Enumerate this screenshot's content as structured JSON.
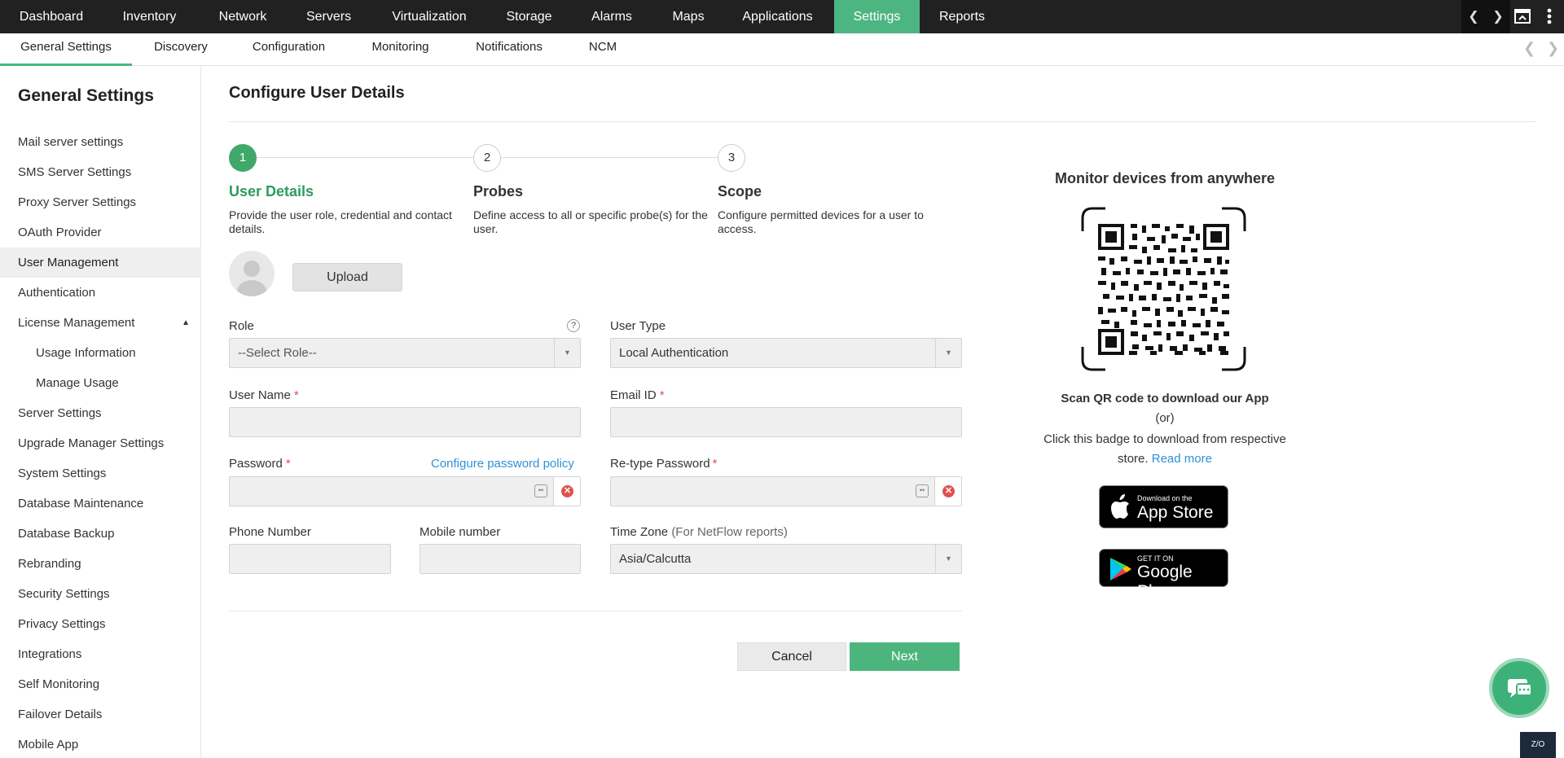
{
  "top_nav": {
    "items": [
      {
        "label": "Dashboard"
      },
      {
        "label": "Inventory"
      },
      {
        "label": "Network"
      },
      {
        "label": "Servers"
      },
      {
        "label": "Virtualization"
      },
      {
        "label": "Storage"
      },
      {
        "label": "Alarms"
      },
      {
        "label": "Maps"
      },
      {
        "label": "Applications"
      },
      {
        "label": "Settings",
        "active": true
      },
      {
        "label": "Reports"
      }
    ]
  },
  "sub_nav": {
    "items": [
      {
        "label": "General Settings",
        "active": true
      },
      {
        "label": "Discovery"
      },
      {
        "label": "Configuration"
      },
      {
        "label": "Monitoring"
      },
      {
        "label": "Notifications"
      },
      {
        "label": "NCM"
      }
    ]
  },
  "sidebar": {
    "title": "General Settings",
    "items": [
      {
        "label": "Mail server settings"
      },
      {
        "label": "SMS Server Settings"
      },
      {
        "label": "Proxy Server Settings"
      },
      {
        "label": "OAuth Provider"
      },
      {
        "label": "User Management",
        "active": true
      },
      {
        "label": "Authentication"
      },
      {
        "label": "License Management",
        "expanded": true
      },
      {
        "label": "Usage Information",
        "sub": true
      },
      {
        "label": "Manage Usage",
        "sub": true
      },
      {
        "label": "Server Settings"
      },
      {
        "label": "Upgrade Manager Settings"
      },
      {
        "label": "System Settings"
      },
      {
        "label": "Database Maintenance"
      },
      {
        "label": "Database Backup"
      },
      {
        "label": "Rebranding"
      },
      {
        "label": "Security Settings"
      },
      {
        "label": "Privacy Settings"
      },
      {
        "label": "Integrations"
      },
      {
        "label": "Self Monitoring"
      },
      {
        "label": "Failover Details"
      },
      {
        "label": "Mobile App"
      }
    ]
  },
  "page": {
    "title": "Configure User Details",
    "steps": [
      {
        "number": "1",
        "title": "User Details",
        "desc": "Provide the user role, credential and contact details.",
        "active": true
      },
      {
        "number": "2",
        "title": "Probes",
        "desc": "Define access to all or specific probe(s) for the user."
      },
      {
        "number": "3",
        "title": "Scope",
        "desc": "Configure permitted devices for a user to access."
      }
    ],
    "upload_label": "Upload"
  },
  "form": {
    "role_label": "Role",
    "role_help": "?",
    "role_value": "--Select Role--",
    "user_type_label": "User Type",
    "user_type_value": "Local Authentication",
    "user_name_label": "User Name",
    "email_label": "Email ID",
    "password_label": "Password",
    "password_policy_link": "Configure password policy",
    "retype_label": "Re-type Password",
    "required_mark": "*",
    "phone_label": "Phone Number",
    "mobile_label": "Mobile number",
    "timezone_label": "Time Zone",
    "timezone_hint": "(For NetFlow reports)",
    "timezone_value": "Asia/Calcutta",
    "cancel_label": "Cancel",
    "next_label": "Next"
  },
  "right_panel": {
    "title": "Monitor devices from anywhere",
    "scan_text": "Scan QR code to download our App",
    "or_text": "(or)",
    "click_text": "Click this badge to download from respective store.",
    "read_more": "Read more",
    "app_store_small": "Download on the",
    "app_store_big": "App Store",
    "google_small": "GET IT ON",
    "google_big": "Google Play"
  },
  "corner_label": "Z/O",
  "colors": {
    "accent": "#4db582",
    "link": "#2f91d6",
    "required": "#e0524f",
    "nav_bg": "#212121"
  }
}
